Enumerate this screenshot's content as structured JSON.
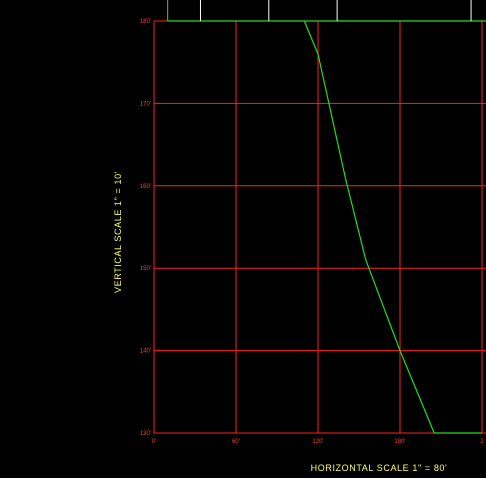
{
  "colors": {
    "background": "#000000",
    "grid": "#ff2020",
    "profile": "#22dd22",
    "frame": "#22dd22",
    "strip_lines": "#ffffff",
    "tick_labels": "#ff3b3b",
    "scale_labels": "#ffff66"
  },
  "labels": {
    "vertical_scale": "VERTICAL SCALE 1\" = 10'",
    "horizontal_scale": "HORIZONTAL SCALE 1\" = 80'"
  },
  "chart_data": {
    "type": "line",
    "title": "",
    "grid": true,
    "x_ticks": [
      0,
      60,
      120,
      180,
      240
    ],
    "x_tick_labels": [
      "0'",
      "60'",
      "120'",
      "180'",
      "2"
    ],
    "y_ticks": [
      130,
      140,
      150,
      160,
      170,
      180
    ],
    "y_tick_labels": [
      "130'",
      "140'",
      "150'",
      "160'",
      "170'",
      "180'"
    ],
    "xlim": [
      0,
      240
    ],
    "ylim": [
      130,
      180
    ],
    "series": [
      {
        "x": [
          110,
          120,
          128,
          140,
          155,
          180,
          205,
          240
        ],
        "y": [
          180,
          176,
          170,
          161,
          151,
          140,
          130,
          130
        ]
      }
    ],
    "top_strip_x": [
      10,
      34,
      84,
      134,
      232
    ]
  }
}
